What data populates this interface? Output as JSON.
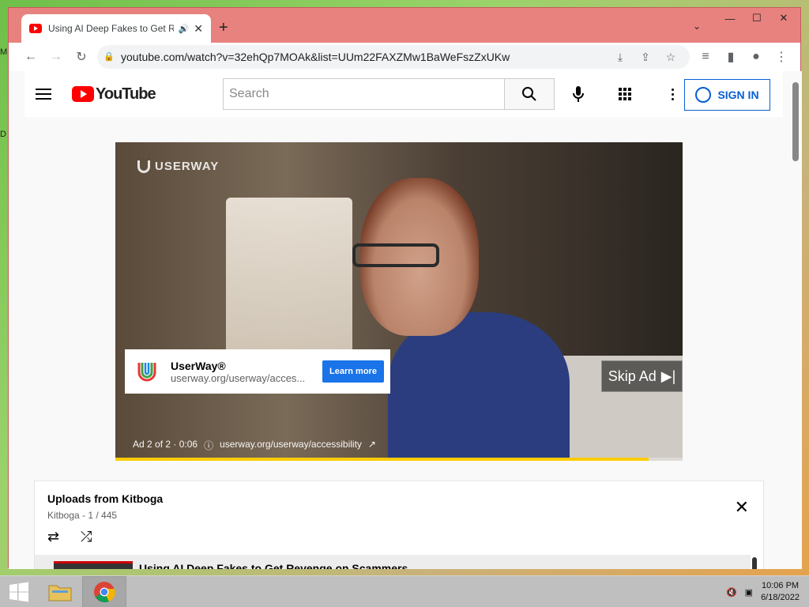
{
  "desktop": {
    "label_m": "M",
    "label_d": "D"
  },
  "browser": {
    "tab": {
      "title": "Using AI Deep Fakes to Get R",
      "audio_icon": "speaker-icon",
      "close": "✕"
    },
    "new_tab": "+",
    "tab_menu": "⌄",
    "window_controls": {
      "minimize": "—",
      "maximize": "☐",
      "close": "✕"
    },
    "url": "youtube.com/watch?v=32ehQp7MOAk&list=UUm22FAXZMw1BaWeFszZxUKw"
  },
  "youtube": {
    "logo_text": "YouTube",
    "search_placeholder": "Search",
    "sign_in": "SIGN IN",
    "player": {
      "watermark": "USERWAY",
      "ad_name": "UserWay®",
      "ad_url": "userway.org/userway/acces...",
      "learn_more": "Learn more",
      "skip": "Skip Ad",
      "ad_counter": "Ad 2 of 2 · 0:06",
      "ad_link": "userway.org/userway/accessibility",
      "progress_fraction": 0.94
    },
    "playlist": {
      "title": "Uploads from Kitboga",
      "subtitle": "Kitboga - 1 / 445",
      "current_title": "Using AI Deep Fakes to Get Revenge on Scammers"
    }
  },
  "taskbar": {
    "time": "10:06 PM",
    "date": "6/18/2022"
  }
}
